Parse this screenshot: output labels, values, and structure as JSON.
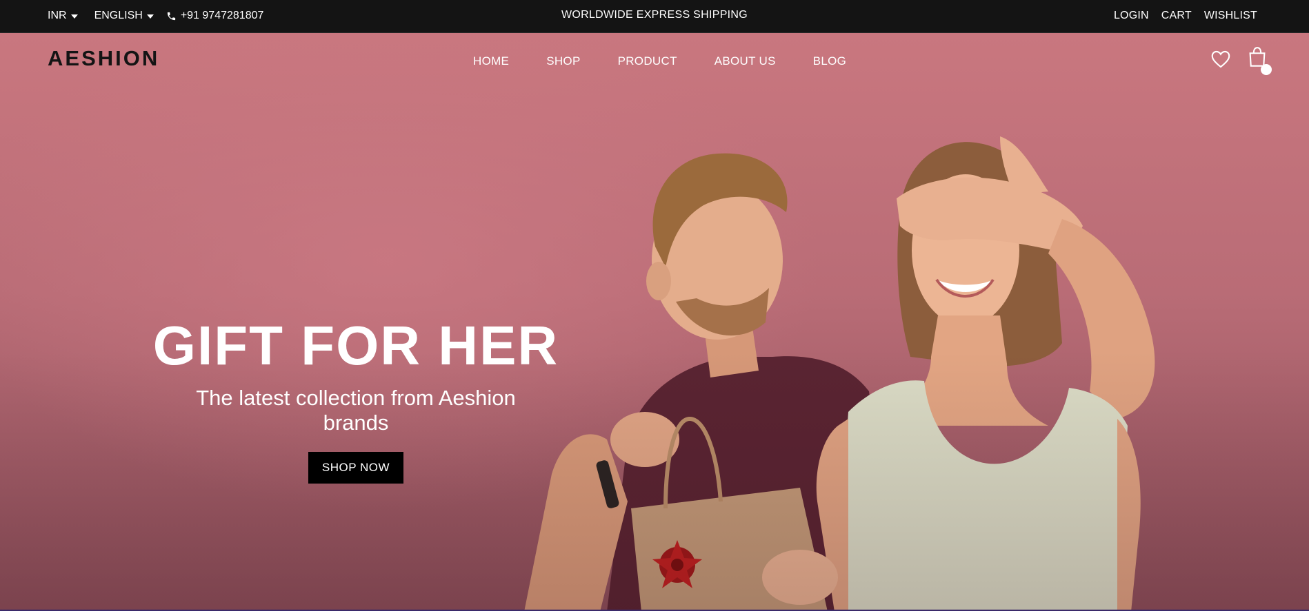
{
  "topbar": {
    "currency": "INR",
    "language": "ENGLISH",
    "phone": "+91 9747281807",
    "announcement": "WORLDWIDE EXPRESS SHIPPING",
    "links": {
      "login": "LOGIN",
      "cart": "CART",
      "wishlist": "WISHLIST"
    }
  },
  "header": {
    "logo": "AESHION",
    "nav": [
      "HOME",
      "SHOP",
      "PRODUCT",
      "ABOUT US",
      "BLOG"
    ],
    "icons": [
      "heart-icon",
      "shopping-bag-icon"
    ]
  },
  "hero": {
    "title": "GIFT FOR HER",
    "subtitle": "The latest collection from Aeshion brands",
    "cta": "SHOP NOW",
    "image_subject": "man covering woman's eyes holding gift bag"
  },
  "colors": {
    "topbar_bg": "#141414",
    "hero_bg": "#c0717a",
    "button_bg": "#000000",
    "logo": "#141414"
  }
}
